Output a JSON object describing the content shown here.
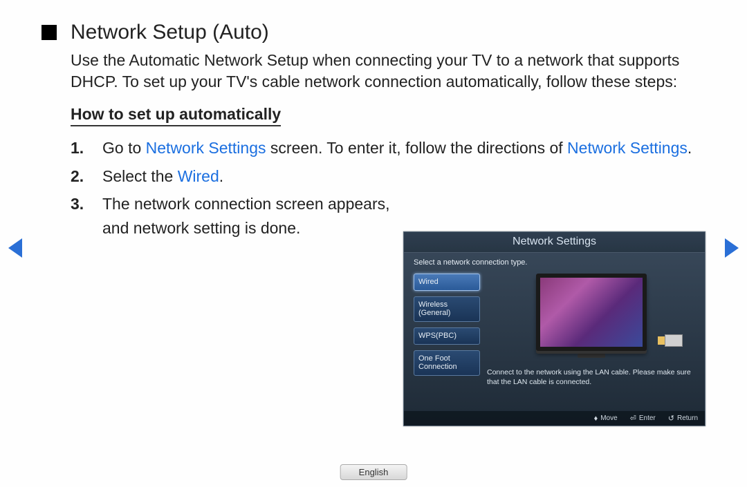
{
  "title": "Network Setup (Auto)",
  "intro": "Use the Automatic Network Setup when connecting your TV to a network that supports DHCP. To set up your TV's cable network connection automatically, follow these steps:",
  "subhead": "How to set up automatically",
  "steps": {
    "s1": {
      "num": "1.",
      "pre": "Go to ",
      "link1": "Network Settings",
      "mid": " screen. To enter it, follow the directions of ",
      "link2": "Network Settings",
      "post": "."
    },
    "s2": {
      "num": "2.",
      "pre": "Select the ",
      "link": "Wired",
      "post": "."
    },
    "s3": {
      "num": "3.",
      "text": "The network connection screen appears, and network setting is done."
    }
  },
  "tv": {
    "title": "Network Settings",
    "instruction": "Select a network connection type.",
    "buttons": {
      "wired": "Wired",
      "wireless": "Wireless (General)",
      "wps": "WPS(PBC)",
      "onefoot": "One Foot Connection"
    },
    "description": "Connect to the network using the LAN cable. Please make sure that the LAN cable is connected.",
    "footer": {
      "move": "Move",
      "enter": "Enter",
      "return": "Return"
    }
  },
  "language": "English"
}
